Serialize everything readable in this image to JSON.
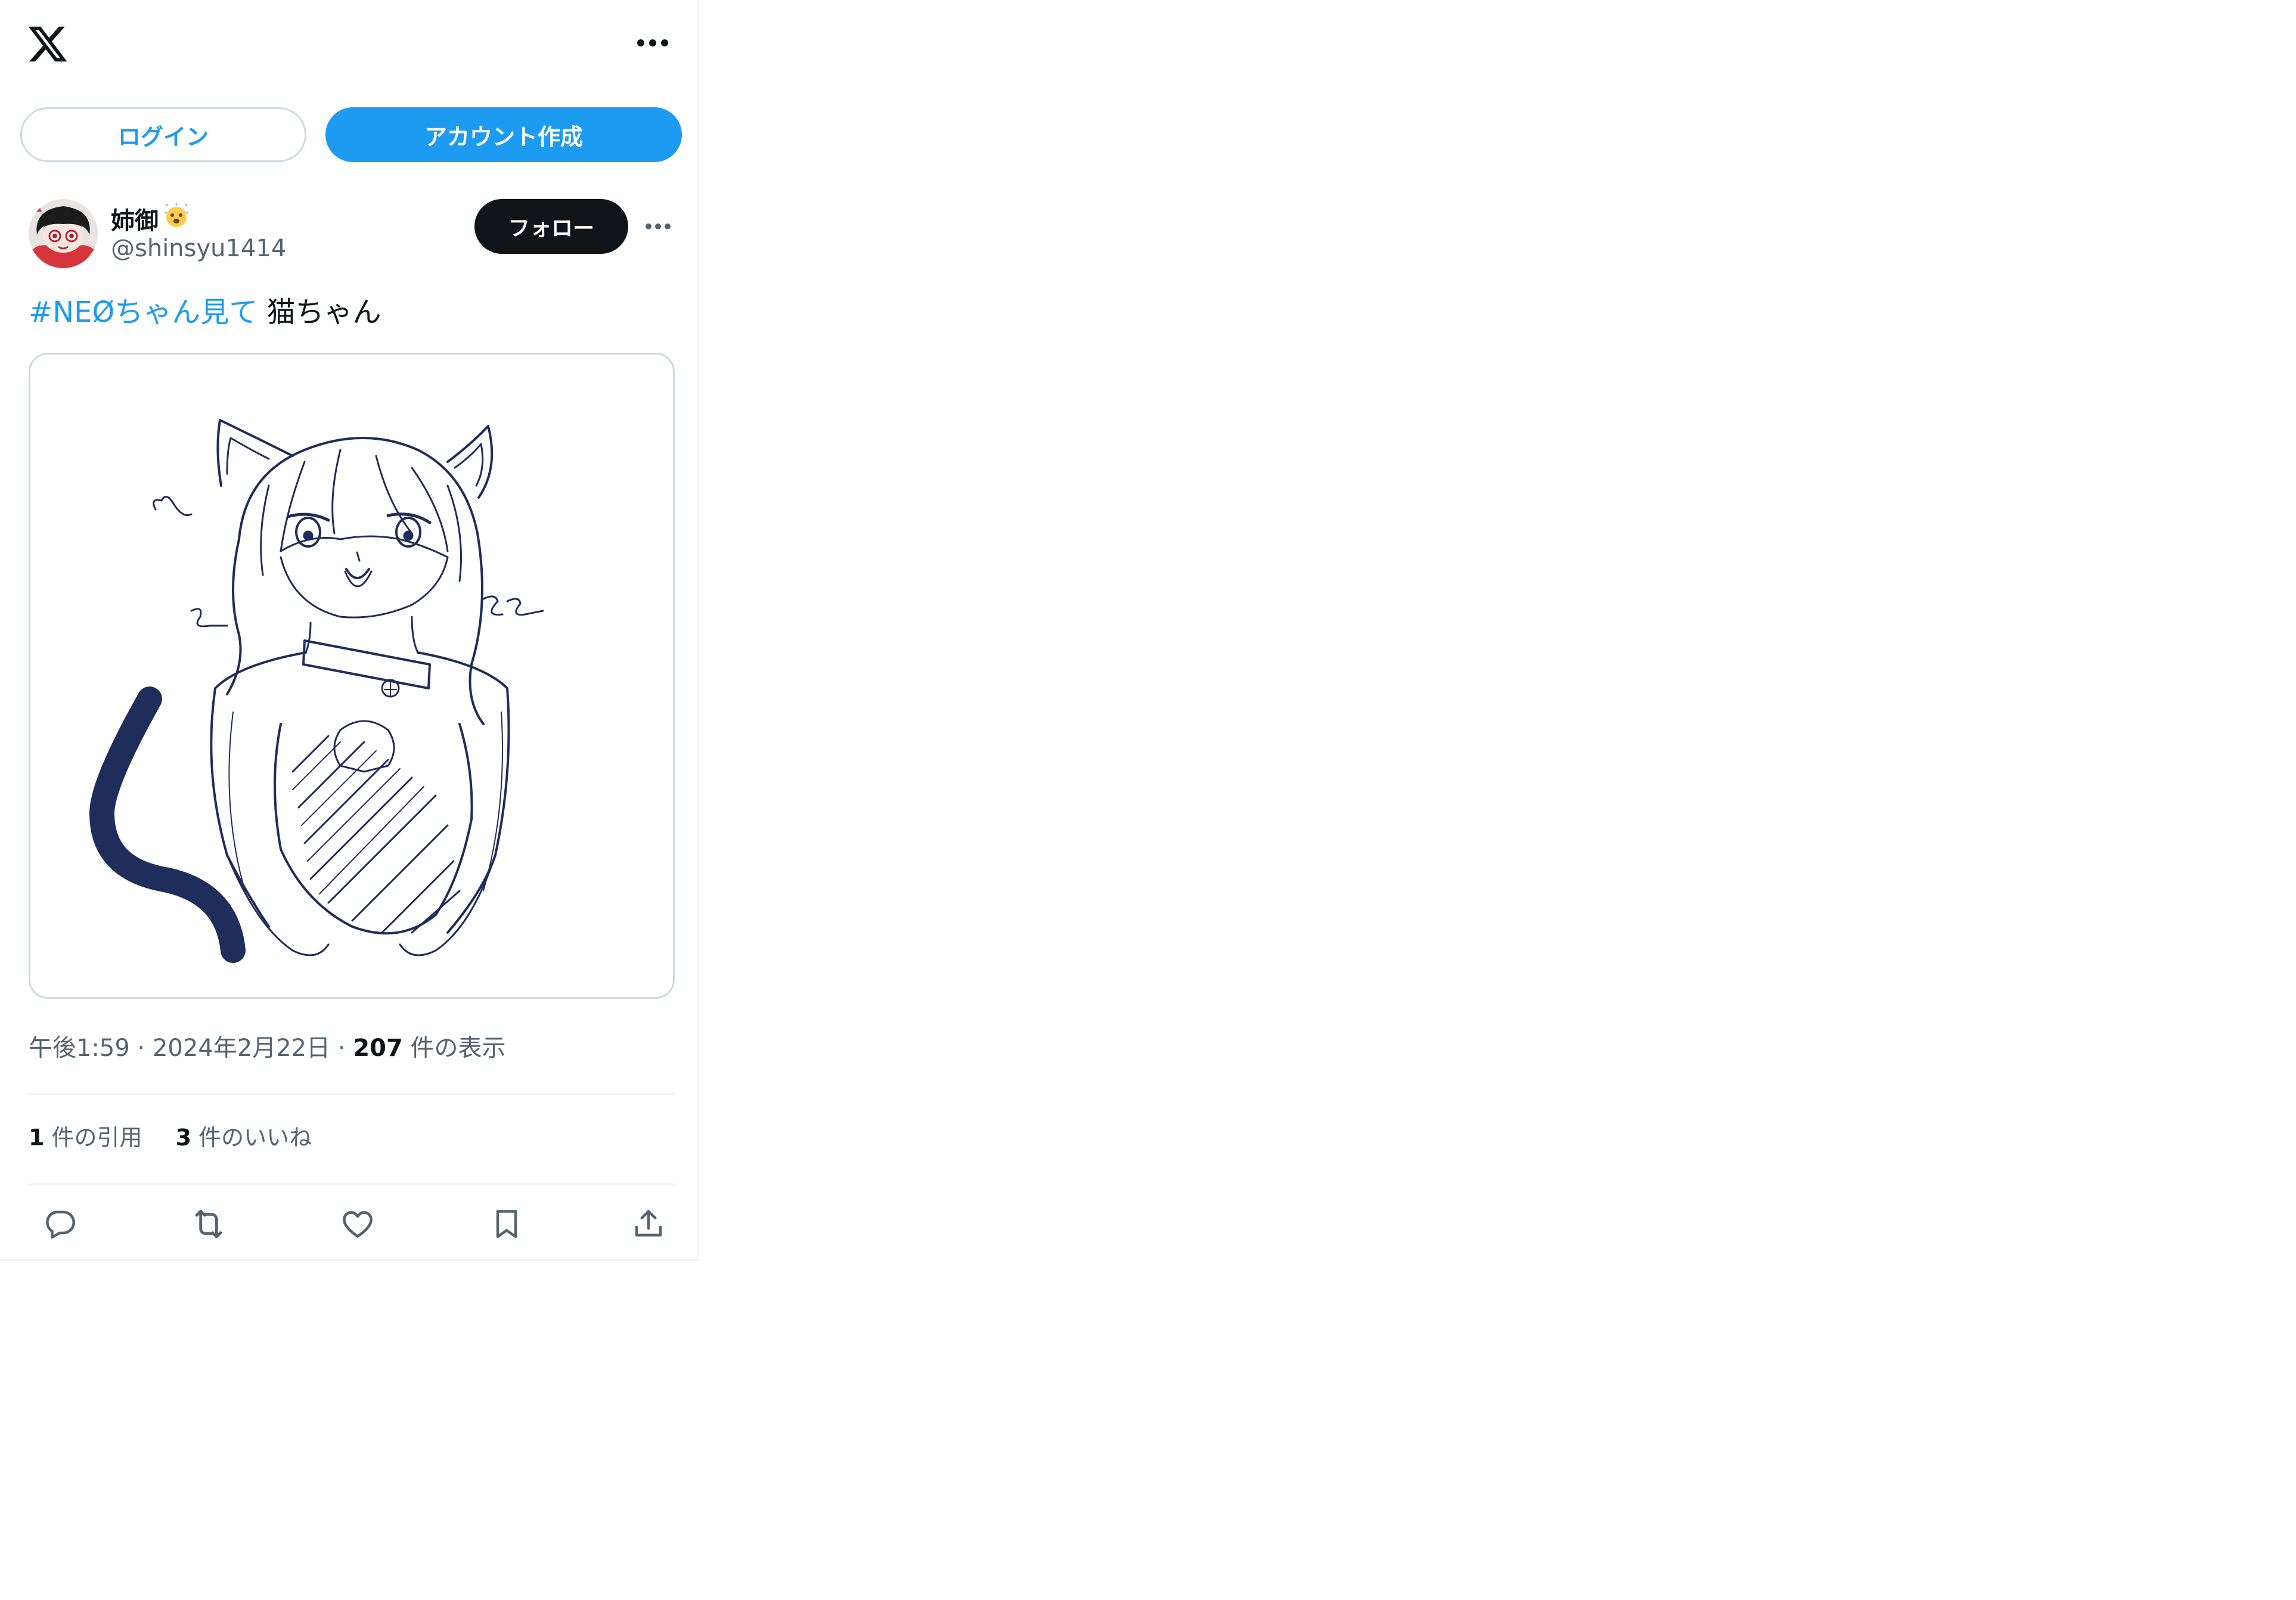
{
  "header": {
    "logo_icon": "x-logo-icon",
    "more_icon": "more-horizontal-icon"
  },
  "auth": {
    "login_label": "ログイン",
    "signup_label": "アカウント作成"
  },
  "tweet": {
    "author": {
      "display_name": "姉御",
      "handle": "@shinsyu1414"
    },
    "follow_label": "フォロー",
    "hashtag": "#NEØちゃん見て",
    "text": " 猫ちゃん",
    "time": "午後1:59",
    "separator": "·",
    "date": "2024年2月22日",
    "views_count": "207",
    "views_label": "件の表示",
    "quotes_count": "1",
    "quotes_label": "件の引用",
    "likes_count": "3",
    "likes_label": "件のいいね"
  },
  "colors": {
    "accent": "#1d9bf0",
    "text": "#0f1419",
    "secondary": "#536471",
    "border": "#cfd9de",
    "sketch": "#1f2d5a"
  }
}
